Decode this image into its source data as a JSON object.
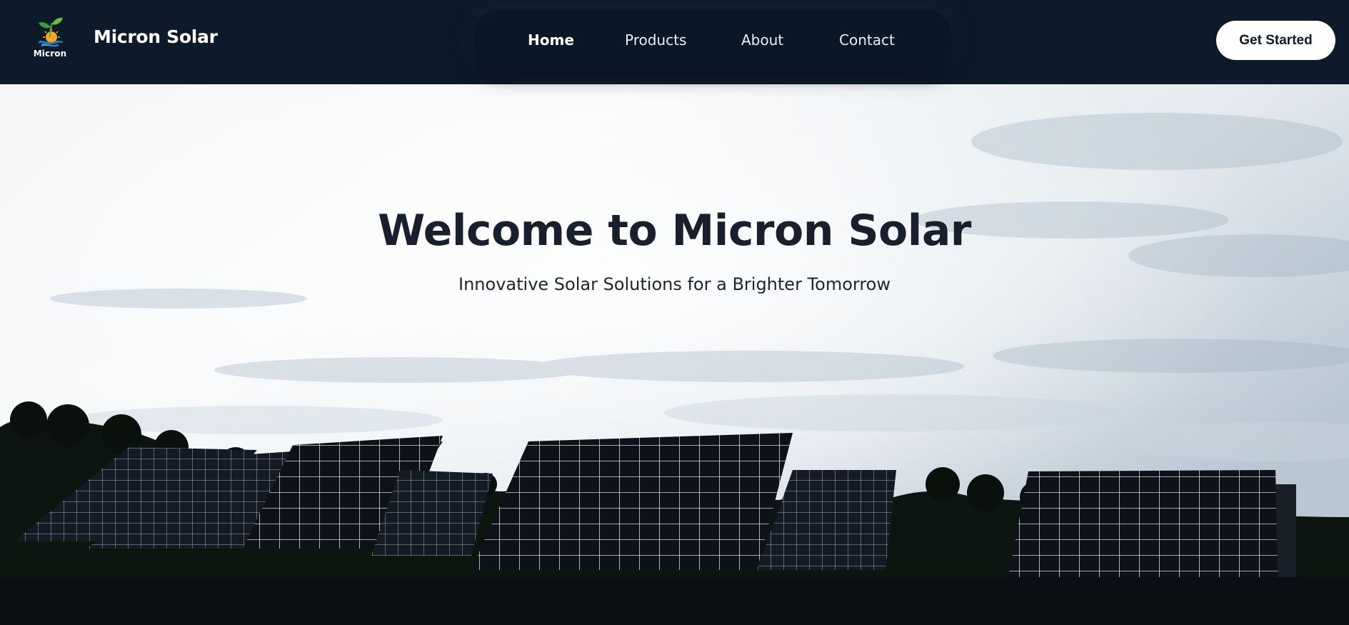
{
  "brand": {
    "logo_text": "Micron",
    "name": "Micron Solar"
  },
  "nav": {
    "items": [
      {
        "label": "Home",
        "active": true
      },
      {
        "label": "Products",
        "active": false
      },
      {
        "label": "About",
        "active": false
      },
      {
        "label": "Contact",
        "active": false
      }
    ]
  },
  "cta": {
    "label": "Get Started"
  },
  "hero": {
    "title": "Welcome to Micron Solar",
    "subtitle": "Innovative Solar Solutions for a Brighter Tomorrow",
    "background_image": "solar-panel-field-under-cloudy-sky"
  },
  "colors": {
    "header_bg": "#0c1a2a",
    "nav_pill_bg": "#0a1726",
    "cta_bg": "#ffffff",
    "hero_text": "#1a1f2e"
  }
}
